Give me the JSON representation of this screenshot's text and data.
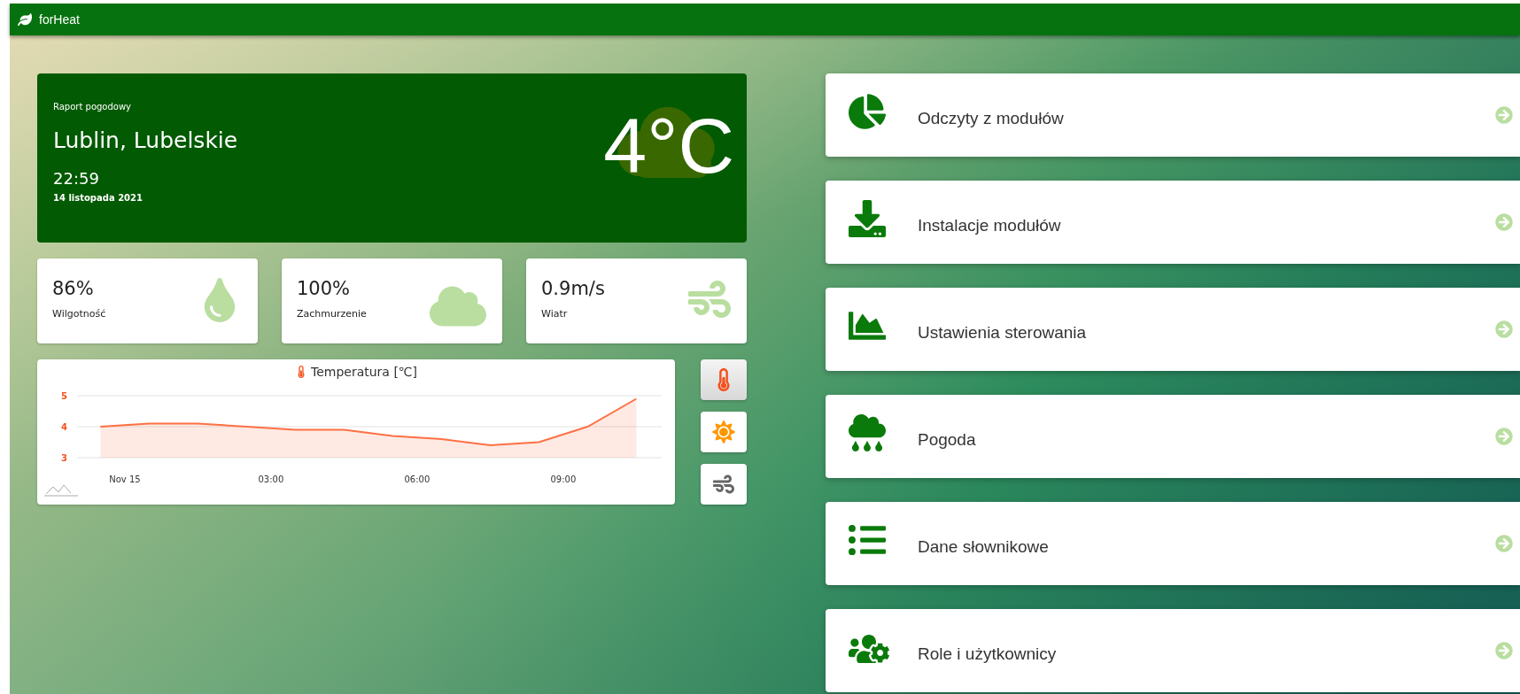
{
  "app": {
    "title": "forHeat"
  },
  "weather": {
    "label": "Raport pogodowy",
    "city": "Lublin, Lubelskie",
    "time": "22:59",
    "date": "14 listopada 2021",
    "temperature": "4°C"
  },
  "stats": [
    {
      "kind": "humidity",
      "value": "86%",
      "label": "Wilgotność"
    },
    {
      "kind": "cloud",
      "value": "100%",
      "label": "Zachmurzenie"
    },
    {
      "kind": "wind",
      "value": "0.9m/s",
      "label": "Wiatr"
    }
  ],
  "chart": {
    "chart_data": {
      "type": "area",
      "title": "Temperatura [℃]",
      "x": [
        -0.5,
        0.5,
        1.5,
        2.5,
        3.5,
        4.5,
        5.5,
        6.5,
        7.5,
        8.5,
        9.5,
        10.5
      ],
      "series": [
        {
          "color": "#ff7043",
          "values": [
            4.0,
            4.1,
            4.1,
            4.0,
            3.9,
            3.9,
            3.7,
            3.6,
            3.4,
            3.5,
            4.0,
            4.9
          ]
        }
      ],
      "xlim": [
        -0.98,
        11.02
      ],
      "ylim": [
        3,
        5
      ],
      "yticks": [
        3,
        4,
        5
      ],
      "xticks": [
        {
          "value": 0,
          "label": "Nov 15"
        },
        {
          "value": 3,
          "label": "03:00"
        },
        {
          "value": 6,
          "label": "06:00"
        },
        {
          "value": 9,
          "label": "09:00"
        }
      ]
    }
  },
  "chart_switch": [
    {
      "kind": "temperature",
      "selected": true
    },
    {
      "kind": "sun",
      "selected": false
    },
    {
      "kind": "wind",
      "selected": false
    }
  ],
  "menu": [
    {
      "kind": "readings",
      "label": "Odczyty z modułów"
    },
    {
      "kind": "install",
      "label": "Instalacje modułów"
    },
    {
      "kind": "control",
      "label": "Ustawienia sterowania"
    },
    {
      "kind": "weather",
      "label": "Pogoda"
    },
    {
      "kind": "dictionary",
      "label": "Dane słownikowe"
    },
    {
      "kind": "users",
      "label": "Role i użytkownicy"
    }
  ]
}
